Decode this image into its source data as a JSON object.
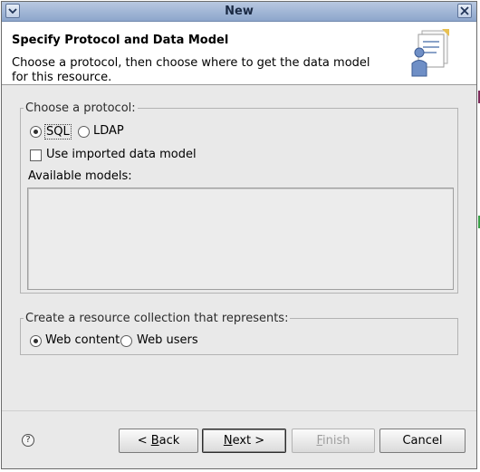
{
  "window": {
    "title": "New"
  },
  "header": {
    "title": "Specify Protocol and Data Model",
    "description": "Choose a protocol, then choose where to get the data model for this resource."
  },
  "protocol_group": {
    "legend": "Choose a protocol:",
    "options": [
      {
        "label": "SQL",
        "checked": true
      },
      {
        "label": "LDAP",
        "checked": false
      }
    ],
    "use_imported_label": "Use imported data model",
    "use_imported_checked": false,
    "available_models_label": "Available models:",
    "available_models": []
  },
  "collection_group": {
    "legend": "Create a resource collection that represents:",
    "options": [
      {
        "label": "Web content",
        "checked": true
      },
      {
        "label": "Web users",
        "checked": false
      }
    ]
  },
  "buttons": {
    "help": "?",
    "back_prefix": "< ",
    "back_mnemonic": "B",
    "back_rest": "ack",
    "next_mnemonic": "N",
    "next_rest": "ext >",
    "finish_mnemonic": "F",
    "finish_rest": "inish",
    "cancel": "Cancel"
  }
}
